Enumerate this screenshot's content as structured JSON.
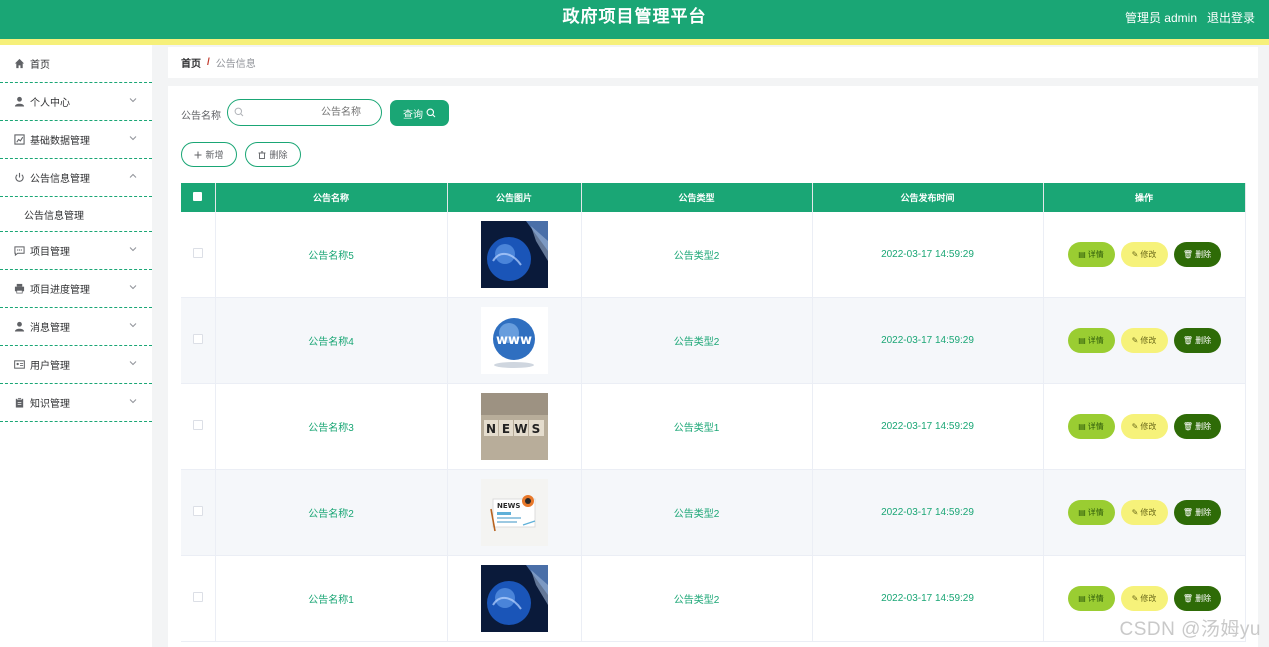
{
  "header": {
    "title": "政府项目管理平台",
    "admin_label": "管理员 admin",
    "logout_label": "退出登录"
  },
  "sidebar": {
    "items": [
      {
        "label": "首页",
        "icon": "home-icon",
        "expandable": false
      },
      {
        "label": "个人中心",
        "icon": "user-icon",
        "expandable": true
      },
      {
        "label": "基础数据管理",
        "icon": "chart-icon",
        "expandable": true
      },
      {
        "label": "公告信息管理",
        "icon": "power-icon",
        "expandable": true,
        "expanded": true
      },
      {
        "label": "项目管理",
        "icon": "message-icon",
        "expandable": true
      },
      {
        "label": "项目进度管理",
        "icon": "printer-icon",
        "expandable": true
      },
      {
        "label": "消息管理",
        "icon": "user-icon",
        "expandable": true
      },
      {
        "label": "用户管理",
        "icon": "id-card-icon",
        "expandable": true
      },
      {
        "label": "知识管理",
        "icon": "clipboard-icon",
        "expandable": true
      }
    ],
    "submenu_label": "公告信息管理"
  },
  "breadcrumb": {
    "home": "首页",
    "separator": "/",
    "current": "公告信息"
  },
  "search": {
    "label": "公告名称",
    "placeholder": "公告名称",
    "query_label": "查询"
  },
  "actions": {
    "add_label": "新增",
    "delete_label": "删除"
  },
  "table": {
    "columns": [
      "公告名称",
      "公告图片",
      "公告类型",
      "公告发布时间",
      "操作"
    ],
    "rows": [
      {
        "name": "公告名称5",
        "image": "globe-blue",
        "type": "公告类型2",
        "time": "2022-03-17 14:59:29"
      },
      {
        "name": "公告名称4",
        "image": "globe-www",
        "type": "公告类型2",
        "time": "2022-03-17 14:59:29"
      },
      {
        "name": "公告名称3",
        "image": "news-blocks",
        "type": "公告类型1",
        "time": "2022-03-17 14:59:29"
      },
      {
        "name": "公告名称2",
        "image": "news-paper",
        "type": "公告类型2",
        "time": "2022-03-17 14:59:29"
      },
      {
        "name": "公告名称1",
        "image": "globe-blue",
        "type": "公告类型2",
        "time": "2022-03-17 14:59:29"
      }
    ],
    "ops": {
      "detail": "详情",
      "edit": "修改",
      "delete": "删除"
    }
  },
  "colors": {
    "primary": "#1aa675",
    "accent_strip": "#f6f07a",
    "detail_btn": "#9acd32",
    "edit_btn": "#f6f27a",
    "delete_btn": "#2e6b07"
  },
  "watermark": "CSDN @汤姆yu"
}
